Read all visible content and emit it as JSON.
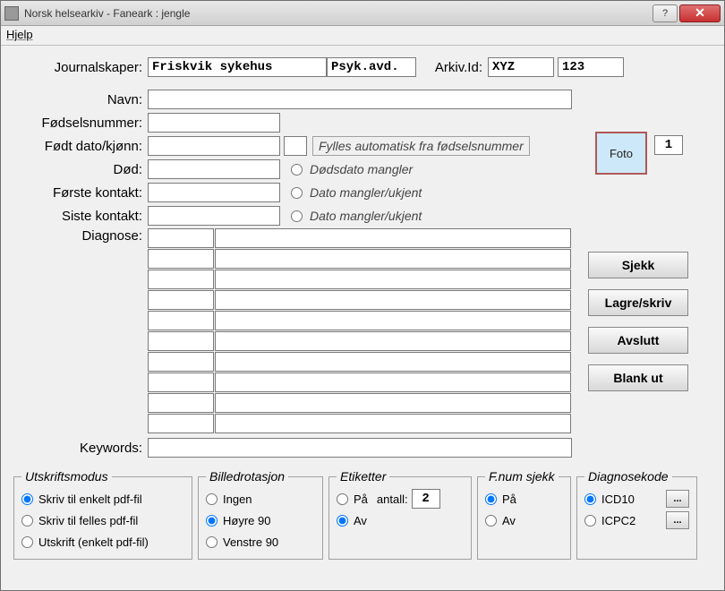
{
  "window": {
    "title": "Norsk helsearkiv - Faneark : jengle"
  },
  "menu": {
    "help": "Hjelp"
  },
  "labels": {
    "journalskaper": "Journalskaper:",
    "arkivid": "Arkiv.Id:",
    "navn": "Navn:",
    "fodselsnummer": "Fødselsnummer:",
    "fodt": "Født dato/kjønn:",
    "dod": "Død:",
    "forste": "Første kontakt:",
    "siste": "Siste kontakt:",
    "diagnose": "Diagnose:",
    "keywords": "Keywords:"
  },
  "values": {
    "journalskaper": "Friskvik sykehus",
    "avdeling": "Psyk.avd.",
    "arkiv_code": "XYZ",
    "arkiv_num": "123",
    "navn": "",
    "fodselsnummer": "",
    "fodt_dato": "",
    "kjonn": "",
    "dod": "",
    "forste": "",
    "siste": "",
    "keywords": "",
    "foto_count": "1",
    "etikett_antall": "2"
  },
  "hints": {
    "fodt": "Fylles automatisk fra fødselsnummer",
    "dod": "Dødsdato mangler",
    "forste": "Dato mangler/ukjent",
    "siste": "Dato mangler/ukjent"
  },
  "foto": {
    "label": "Foto"
  },
  "buttons": {
    "sjekk": "Sjekk",
    "lagre": "Lagre/skriv",
    "avslutt": "Avslutt",
    "blank": "Blank ut"
  },
  "groups": {
    "utskrift": {
      "legend": "Utskriftsmodus",
      "opt1": "Skriv til enkelt pdf-fil",
      "opt2": "Skriv til felles pdf-fil",
      "opt3": "Utskrift (enkelt pdf-fil)"
    },
    "rotasjon": {
      "legend": "Billedrotasjon",
      "opt1": "Ingen",
      "opt2": "Høyre 90",
      "opt3": "Venstre 90"
    },
    "etiketter": {
      "legend": "Etiketter",
      "opt1": "På",
      "antall": "antall:",
      "opt2": "Av"
    },
    "fnum": {
      "legend": "F.num sjekk",
      "opt1": "På",
      "opt2": "Av"
    },
    "diagkode": {
      "legend": "Diagnosekode",
      "opt1": "ICD10",
      "opt2": "ICPC2",
      "more": "..."
    }
  }
}
